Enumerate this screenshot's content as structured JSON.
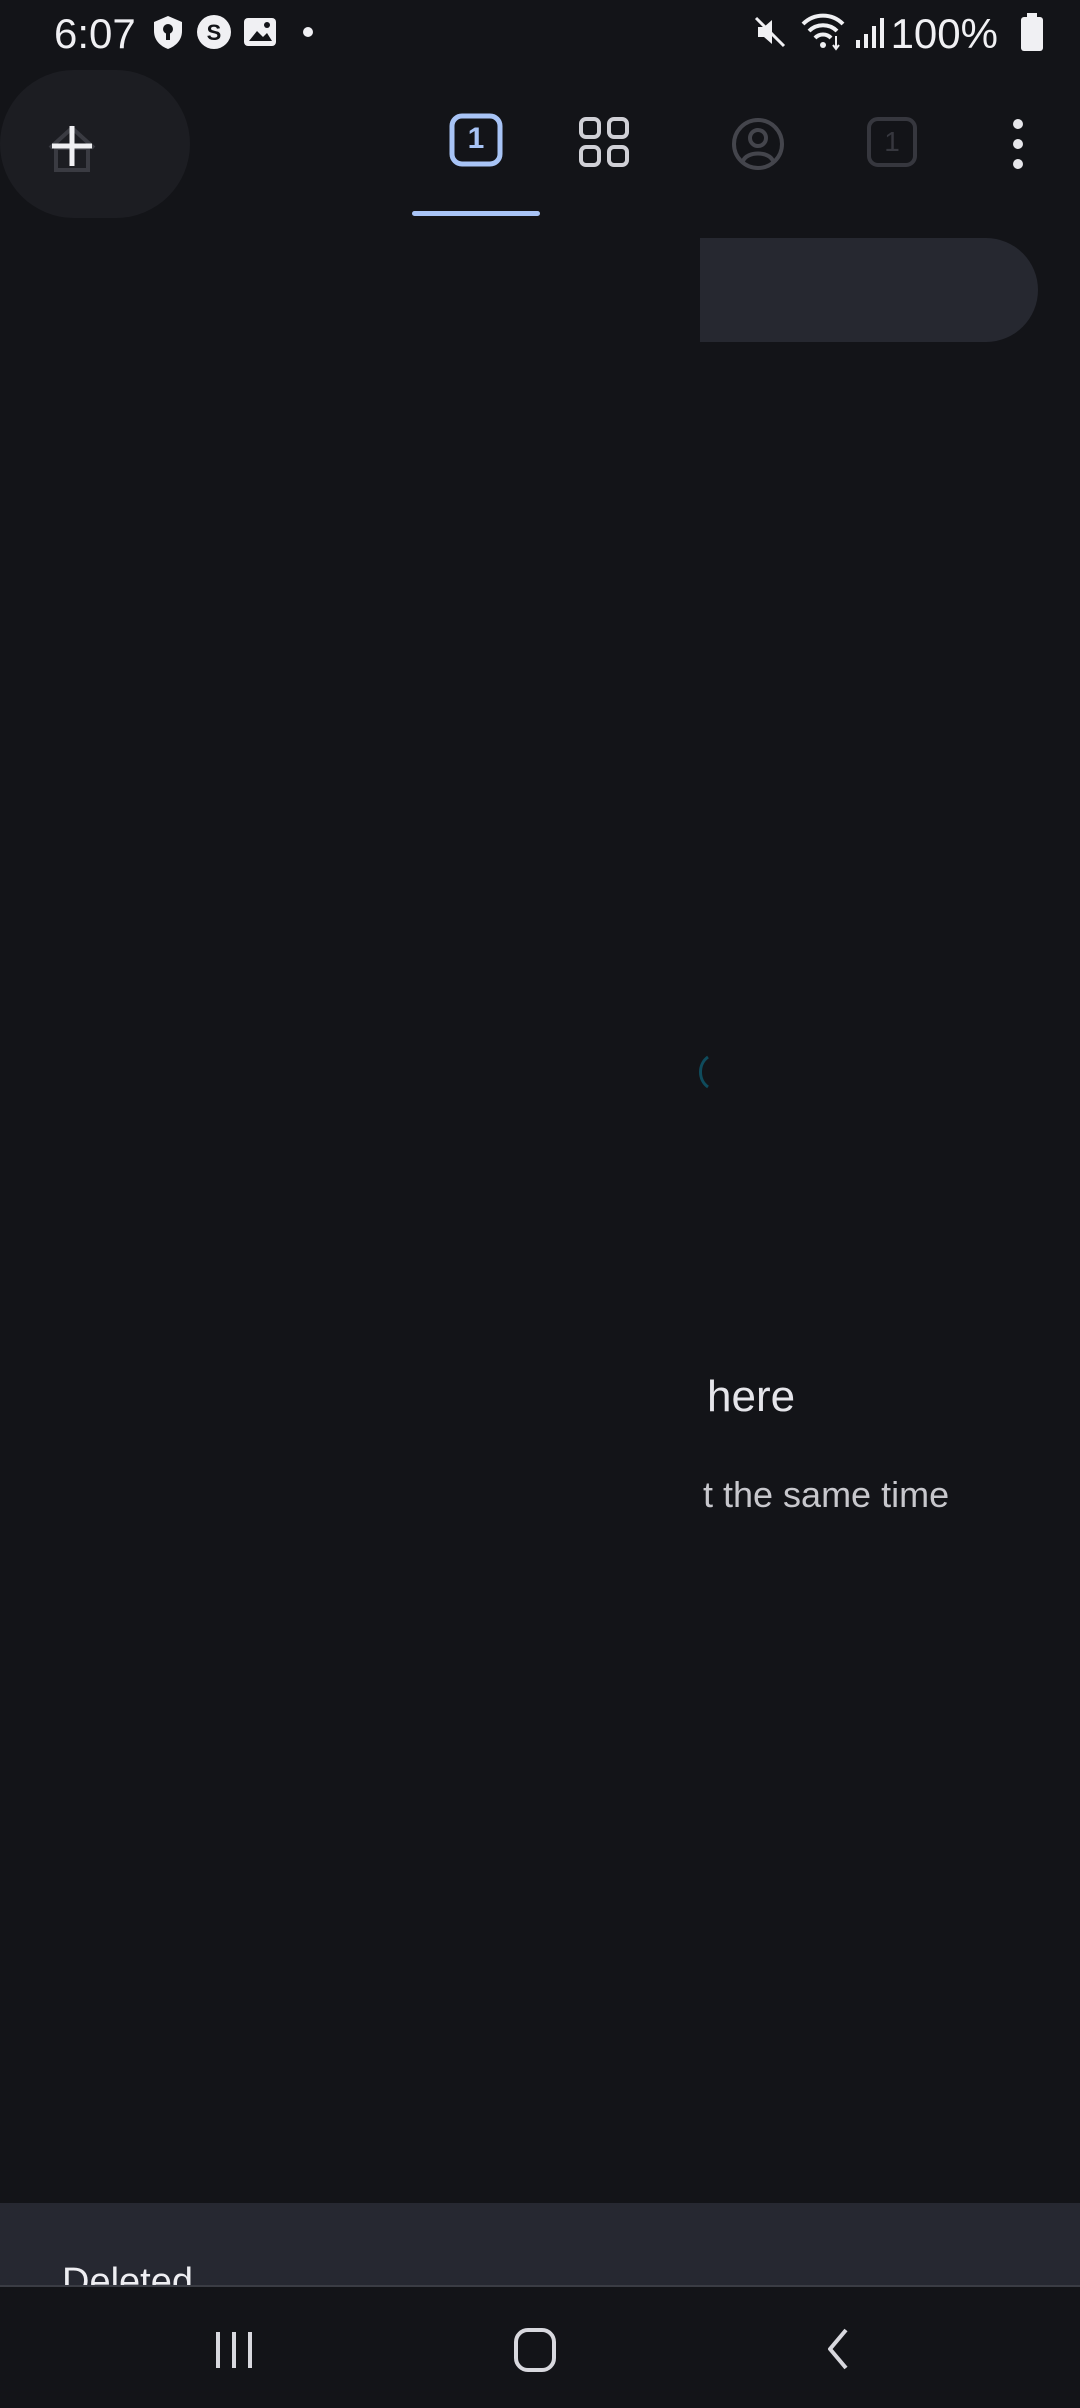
{
  "status_bar": {
    "time": "6:07",
    "battery": "100%",
    "icons_left": [
      "shield-icon",
      "s-app-icon",
      "image-icon",
      "dot-icon"
    ],
    "icons_right": [
      "mute-icon",
      "wifi-icon",
      "signal-icon",
      "battery-icon"
    ]
  },
  "toolbar": {
    "incognito_tab_count": "1",
    "ghost_tab_count": "1",
    "accent_color": "#a8c4f6"
  },
  "empty_state": {
    "title": "here",
    "subtitle": "t the same time"
  },
  "snackbar": {
    "message": "Deleted"
  }
}
